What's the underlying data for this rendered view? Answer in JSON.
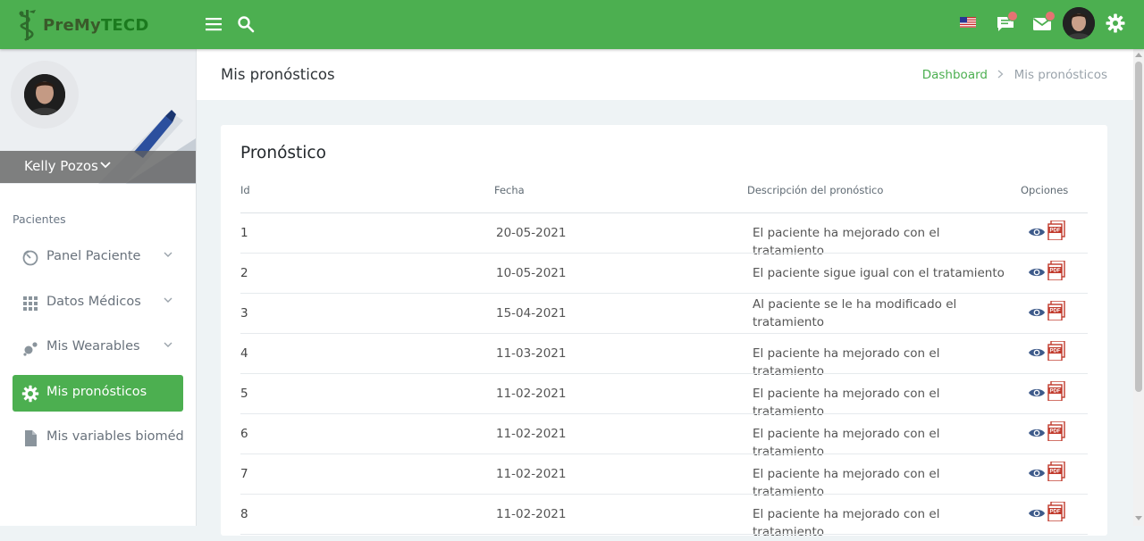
{
  "brand": {
    "pre": "PreMy",
    "tecd": "TECD"
  },
  "user": {
    "name": "Kelly Pozos"
  },
  "sidebar": {
    "section": "Pacientes",
    "items": [
      {
        "label": "Panel Paciente",
        "icon": "dashboard-icon",
        "has_chevron": true,
        "active": false
      },
      {
        "label": "Datos Médicos",
        "icon": "grid-icon",
        "has_chevron": true,
        "active": false
      },
      {
        "label": "Mis Wearables",
        "icon": "bubbles-icon",
        "has_chevron": true,
        "active": false
      },
      {
        "label": "Mis pronósticos",
        "icon": "gear-icon",
        "has_chevron": false,
        "active": true
      },
      {
        "label": "Mis variables biomédic",
        "icon": "file-icon",
        "has_chevron": false,
        "active": false
      }
    ]
  },
  "page": {
    "title": "Mis pronósticos",
    "breadcrumb": {
      "home": "Dashboard",
      "current": "Mis pronósticos"
    }
  },
  "card": {
    "title": "Pronóstico",
    "columns": {
      "id": "Id",
      "date": "Fecha",
      "desc": "Descripción del pronóstico",
      "options": "Opciones"
    }
  },
  "rows": [
    {
      "id": "1",
      "date": "20-05-2021",
      "desc": "El paciente ha mejorado con el tratamiento"
    },
    {
      "id": "2",
      "date": "10-05-2021",
      "desc": "El paciente sigue igual con el tratamiento"
    },
    {
      "id": "3",
      "date": "15-04-2021",
      "desc": "Al paciente se le ha modificado el tratamiento"
    },
    {
      "id": "4",
      "date": "11-03-2021",
      "desc": "El paciente ha mejorado con el tratamiento"
    },
    {
      "id": "5",
      "date": "11-02-2021",
      "desc": "El paciente ha mejorado con el tratamiento"
    },
    {
      "id": "6",
      "date": "11-02-2021",
      "desc": "El paciente ha mejorado con el tratamiento"
    },
    {
      "id": "7",
      "date": "11-02-2021",
      "desc": "El paciente ha mejorado con el tratamiento"
    },
    {
      "id": "8",
      "date": "11-02-2021",
      "desc": "El paciente ha mejorado con el tratamiento"
    }
  ],
  "row_actions": {
    "pdf_label": "PDF"
  },
  "colors": {
    "primary": "#4caf50",
    "eye": "#3d5a8a",
    "pdf": "#c0392b"
  }
}
